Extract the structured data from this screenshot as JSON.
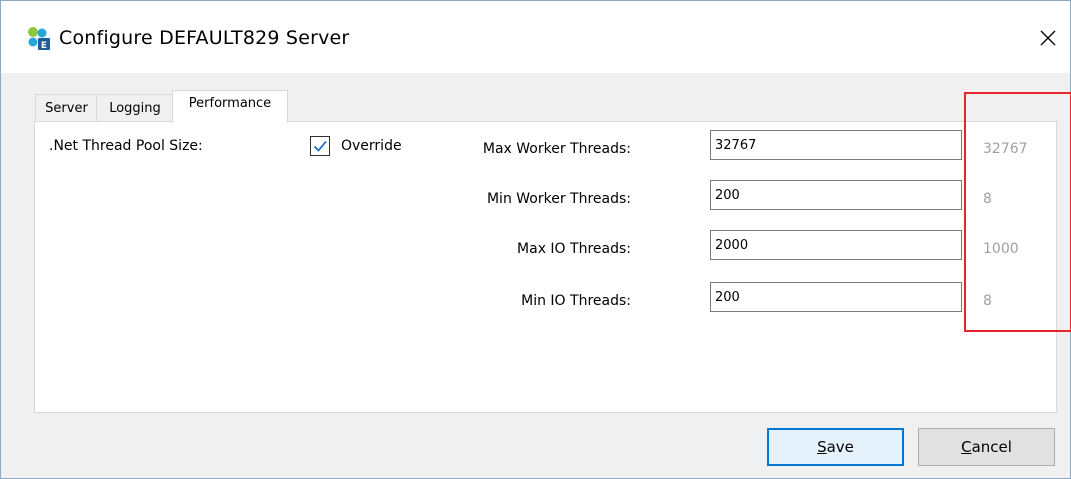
{
  "window": {
    "title": "Configure DEFAULT829 Server",
    "app_icon": "server-config-icon",
    "close_icon": "close-icon"
  },
  "tabs": [
    {
      "label": "Server",
      "active": false
    },
    {
      "label": "Logging",
      "active": false
    },
    {
      "label": "Performance",
      "active": true
    }
  ],
  "performance": {
    "pool_label": ".Net Thread Pool Size:",
    "override": {
      "label": "Override",
      "checked": true
    },
    "fields": [
      {
        "label": "Max Worker Threads:",
        "value": "32767",
        "default": "32767"
      },
      {
        "label": "Min Worker Threads:",
        "value": "200",
        "default": "8"
      },
      {
        "label": "Max IO Threads:",
        "value": "2000",
        "default": "1000"
      },
      {
        "label": "Min IO Threads:",
        "value": "200",
        "default": "8"
      }
    ]
  },
  "buttons": {
    "save": {
      "mnemonic": "S",
      "rest": "ave"
    },
    "cancel": {
      "mnemonic": "C",
      "rest": "ancel"
    }
  },
  "colors": {
    "highlight": "#e8262a",
    "default_button_border": "#0078d7",
    "muted_text": "#a0a0a0"
  }
}
